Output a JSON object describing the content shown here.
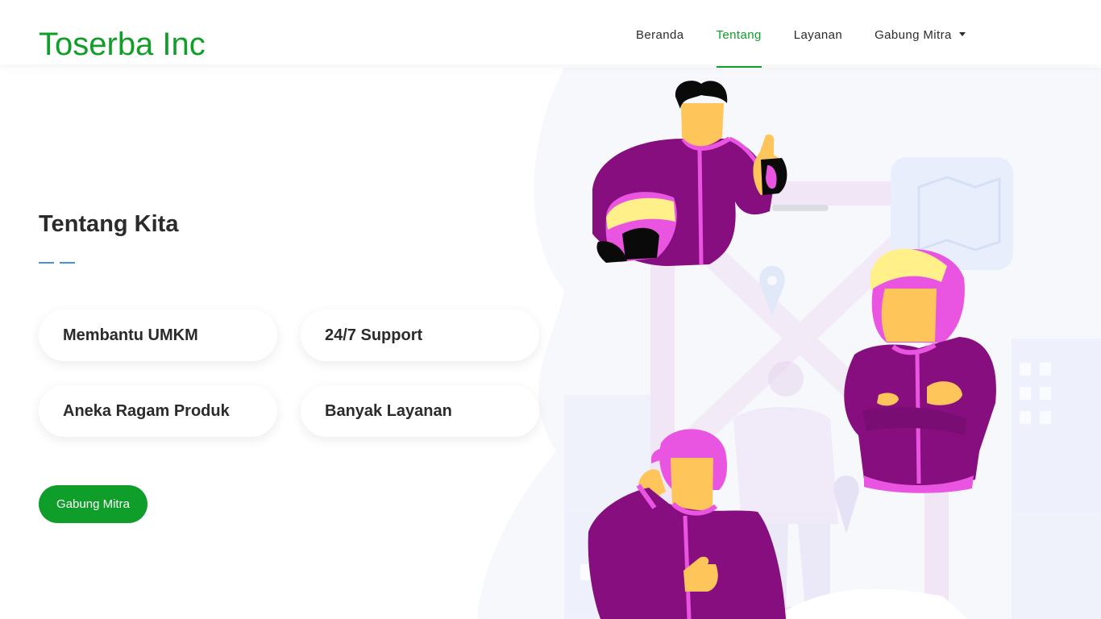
{
  "brand": {
    "name": "Toserba Inc"
  },
  "nav": {
    "items": [
      {
        "label": "Beranda",
        "active": false
      },
      {
        "label": "Tentang",
        "active": true
      },
      {
        "label": "Layanan",
        "active": false
      },
      {
        "label": "Gabung Mitra",
        "active": false,
        "dropdown": true
      }
    ]
  },
  "about": {
    "title": "Tentang Kita",
    "features": [
      "Membantu UMKM",
      "24/7 Support",
      "Aneka Ragam Produk",
      "Banyak Layanan"
    ],
    "cta_label": "Gabung Mitra"
  },
  "colors": {
    "brand_green": "#109e29",
    "jacket_purple": "#860e7f",
    "helmet_pink": "#e954e0",
    "skin": "#fec55a",
    "visor_yellow": "#fff08a",
    "underline_blue": "#4a90d9"
  }
}
